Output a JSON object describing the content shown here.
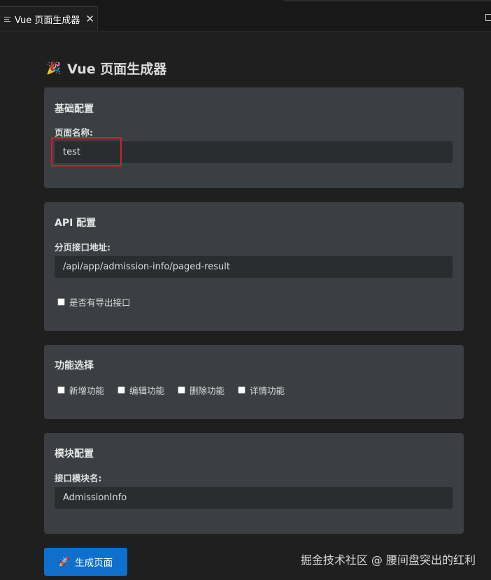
{
  "tab": {
    "title": "Vue 页面生成器",
    "close": "✕"
  },
  "page": {
    "title": "Vue 页面生成器",
    "icon": "🎉"
  },
  "basic": {
    "title": "基础配置",
    "page_name_label": "页面名称:",
    "page_name_value": "test"
  },
  "api": {
    "title": "API 配置",
    "url_label": "分页接口地址:",
    "url_value": "/api/app/admission-info/paged-result",
    "export_label": "是否有导出接口"
  },
  "features": {
    "title": "功能选择",
    "items": [
      {
        "label": "新增功能"
      },
      {
        "label": "编辑功能"
      },
      {
        "label": "删除功能"
      },
      {
        "label": "详情功能"
      }
    ]
  },
  "module": {
    "title": "模块配置",
    "name_label": "接口模块名:",
    "name_value": "AdmissionInfo"
  },
  "button": {
    "label": "生成页面",
    "icon": "🚀"
  },
  "watermark": "掘金技术社区 @ 腰间盘突出的红利",
  "icons": {
    "tab_menu": "menu-lines-icon",
    "close": "close-icon",
    "layout": "split-layout-icon",
    "title": "party-popper-icon",
    "button": "rocket-icon"
  },
  "colors": {
    "background": "#1f1f1f",
    "card": "#3b3f43",
    "input": "#2a2d2f",
    "primary": "#0e70cc",
    "highlight": "#d21f2c"
  }
}
